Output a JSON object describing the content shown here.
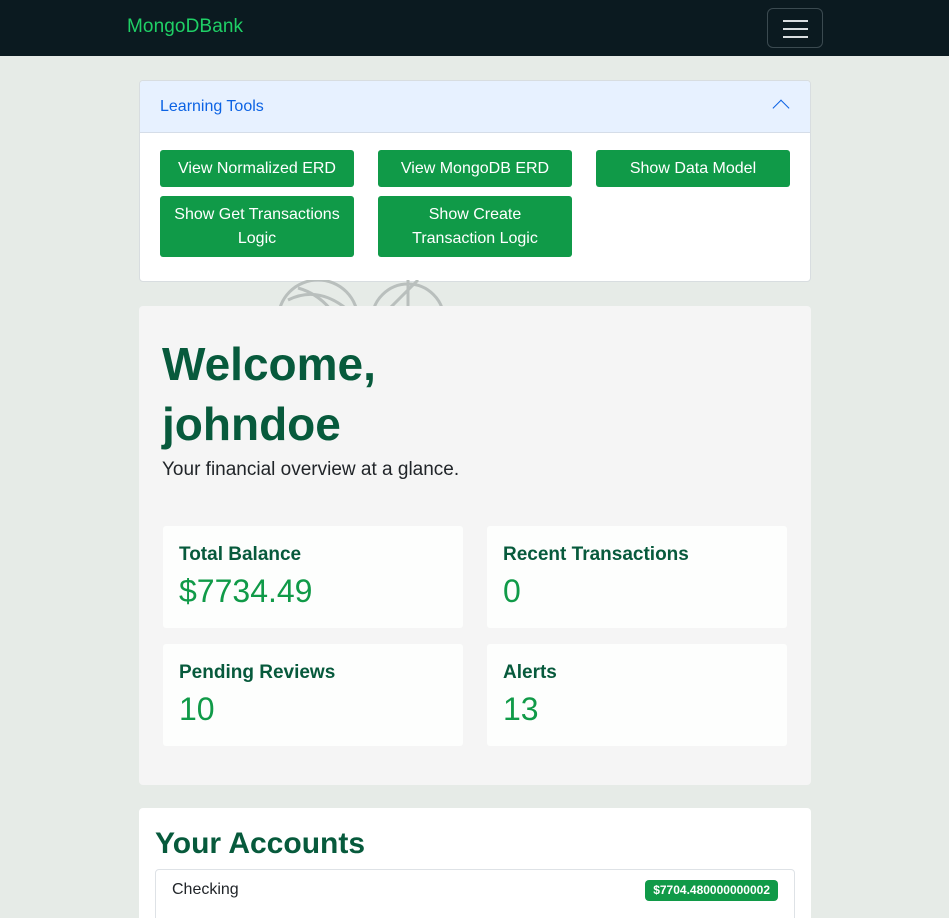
{
  "navbar": {
    "brand": "MongoDBank",
    "toggle_icon": "hamburger-menu-icon"
  },
  "learning_tools": {
    "title": "Learning Tools",
    "collapse_icon": "chevron-up-icon",
    "buttons": [
      "View Normalized ERD",
      "View MongoDB ERD",
      "Show Data Model",
      "Show Get Transactions Logic",
      "Show Create Transaction Logic"
    ]
  },
  "hero": {
    "welcome": "Welcome, johndoe",
    "subtitle": "Your financial overview at a glance."
  },
  "stats": [
    {
      "label": "Total Balance",
      "value": "$7734.49"
    },
    {
      "label": "Recent Transactions",
      "value": "0"
    },
    {
      "label": "Pending Reviews",
      "value": "10"
    },
    {
      "label": "Alerts",
      "value": "13"
    }
  ],
  "accounts": {
    "heading": "Your Accounts",
    "items": [
      {
        "name": "Checking",
        "balance": "$7704.480000000002"
      }
    ]
  },
  "colors": {
    "navbar_bg": "#0b1a20",
    "brand": "#1fd066",
    "accent_green": "#109a48",
    "heading_green": "#075a3c",
    "accordion_header_bg": "#e7f1ff",
    "link_blue": "#0c63e4",
    "page_bg": "#e6ebe7"
  }
}
